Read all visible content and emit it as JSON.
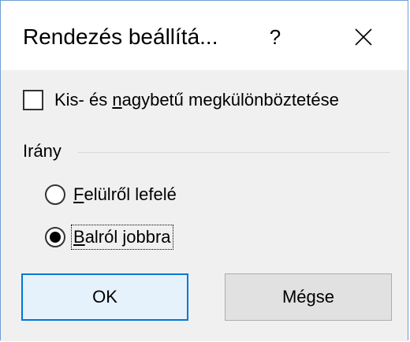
{
  "dialog": {
    "title": "Rendezés beállítá...",
    "help_label": "?",
    "close_icon": "close-icon"
  },
  "options": {
    "case_sensitive": {
      "label_prefix": "Kis- és ",
      "label_access": "n",
      "label_suffix": "agybetű megkülönböztetése",
      "checked": false
    }
  },
  "direction": {
    "group_label": "Irány",
    "items": [
      {
        "access": "F",
        "rest": "elülről lefelé",
        "checked": false
      },
      {
        "access": "B",
        "rest": "alról jobbra",
        "checked": true
      }
    ]
  },
  "buttons": {
    "ok_label": "OK",
    "cancel_label": "Mégse"
  },
  "colors": {
    "accent": "#0078d7",
    "border": "#6d9fd5",
    "body_bg": "#f0f0f0"
  }
}
